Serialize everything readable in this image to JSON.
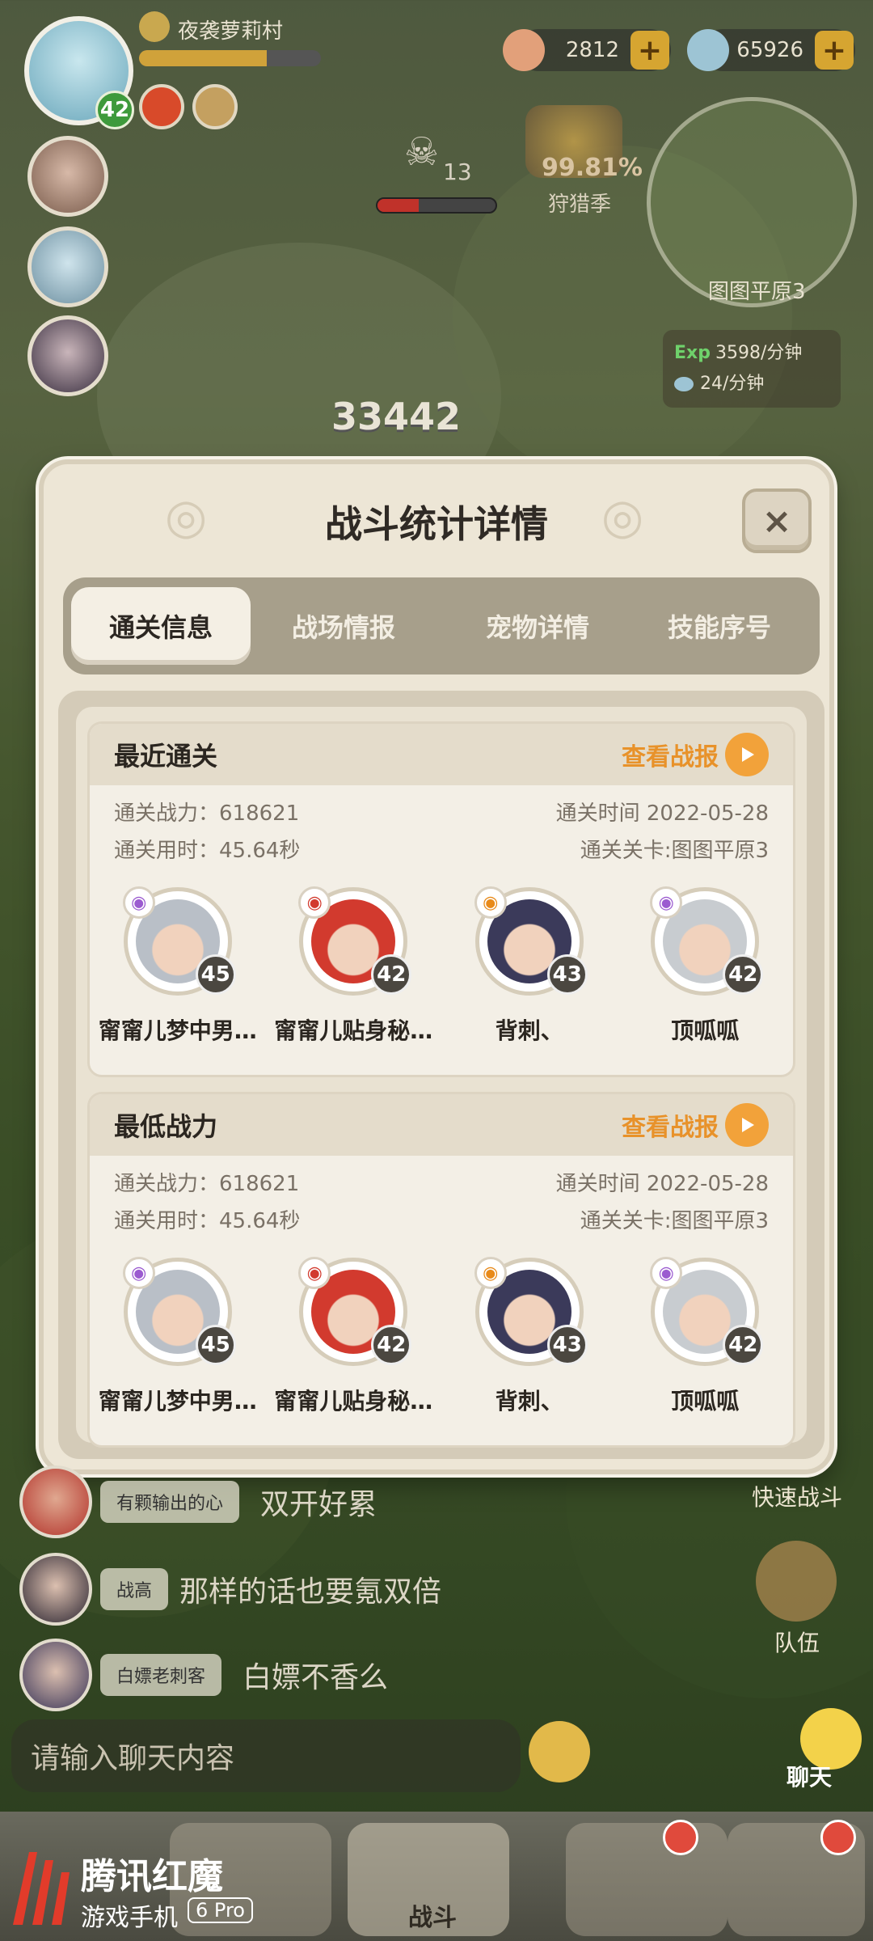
{
  "hud": {
    "player_name": "夜袭萝莉村",
    "level": "42",
    "exp_fill": 0.7,
    "currency1": "2812",
    "currency2": "65926",
    "plus": "+",
    "hunt_percent": "99.81%",
    "hunt_label": "狩猎季",
    "kill_count": "13",
    "boss_hp_fill": 0.35,
    "map_name": "图图平原3",
    "exp_rate_label": "Exp",
    "exp_rate": "3598/分钟",
    "coin_rate": "24/分钟",
    "damage_number": "33442"
  },
  "modal": {
    "title": "战斗统计详情",
    "close": "×",
    "tabs": [
      {
        "label": "通关信息",
        "active": true
      },
      {
        "label": "战场情报",
        "active": false
      },
      {
        "label": "宠物详情",
        "active": false
      },
      {
        "label": "技能序号",
        "active": false
      }
    ],
    "sections": [
      {
        "title": "最近通关",
        "view_report": "查看战报",
        "power_label": "通关战力：618621",
        "duration_label": "通关用时：45.64秒",
        "time_label": "通关时间  2022-05-28",
        "stage_label": "通关关卡:图图平原3",
        "members": [
          {
            "name": "甯甯儿梦中男…",
            "level": "45",
            "color": "#b9bfc7"
          },
          {
            "name": "甯甯儿贴身秘…",
            "level": "42",
            "color": "#d23a2e"
          },
          {
            "name": "背刺、",
            "level": "43",
            "color": "#3b3a5a"
          },
          {
            "name": "顶呱呱",
            "level": "42",
            "color": "#c8ccd0"
          }
        ]
      },
      {
        "title": "最低战力",
        "view_report": "查看战报",
        "power_label": "通关战力：618621",
        "duration_label": "通关用时：45.64秒",
        "time_label": "通关时间  2022-05-28",
        "stage_label": "通关关卡:图图平原3",
        "members": [
          {
            "name": "甯甯儿梦中男…",
            "level": "45",
            "color": "#b9bfc7"
          },
          {
            "name": "甯甯儿贴身秘…",
            "level": "42",
            "color": "#d23a2e"
          },
          {
            "name": "背刺、",
            "level": "43",
            "color": "#3b3a5a"
          },
          {
            "name": "顶呱呱",
            "level": "42",
            "color": "#c8ccd0"
          }
        ]
      }
    ]
  },
  "chat": {
    "messages": [
      {
        "name": "有颗输出的心",
        "text": "双开好累"
      },
      {
        "name": "战高",
        "text": "那样的话也要氪双倍"
      },
      {
        "name": "白嫖老刺客",
        "text": "白嫖不香么"
      }
    ],
    "input_placeholder": "请输入聊天内容"
  },
  "side": {
    "quick_battle": "快速战斗",
    "team": "队伍",
    "chat": "聊天"
  },
  "bottom": {
    "battle": "战斗",
    "brand": "腾讯红魔",
    "brand_sub": "游戏手机",
    "brand_badge": "6 Pro"
  }
}
